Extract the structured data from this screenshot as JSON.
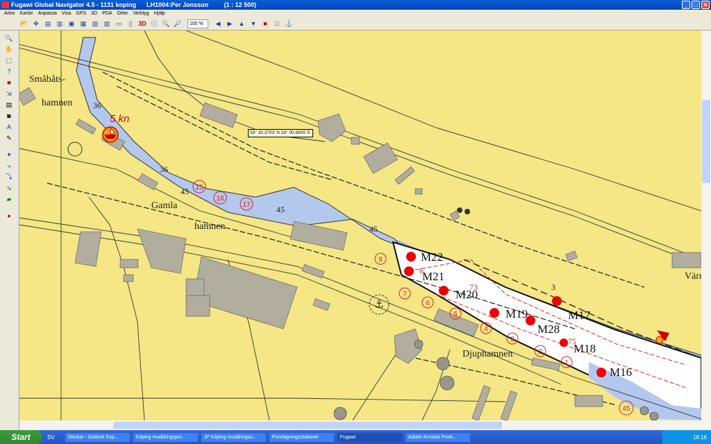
{
  "window": {
    "title": "Fugawi Global Navigator 4.5 - 1131 koping      LH1004:Per Jonsson         (1 : 12 500)",
    "buttons": [
      "_",
      "□",
      "✕"
    ]
  },
  "menu": [
    "Arkiv",
    "Kartor",
    "Anpassa",
    "Visa",
    "GPS",
    "3D",
    "PDA",
    "Orter",
    "Verktyg",
    "Hjälp"
  ],
  "toolbar": {
    "zoom": "100 %"
  },
  "map": {
    "tooltip": "59° 30,3703' N 16° 00,6905' E",
    "place_names": {
      "smabats": "Småbåts-",
      "hamnen1": "hamnen",
      "gamla": "Gamla",
      "hamnen2": "hamnen",
      "djuphamnen": "Djuphamnen",
      "varn": "Värn"
    },
    "speed_label": "5 kn",
    "depths": [
      "36",
      "36",
      "45",
      "45",
      "45",
      "3",
      "75",
      "73",
      "6"
    ],
    "circled_numbers": [
      "15",
      "16",
      "17",
      "8",
      "7",
      "6",
      "5",
      "4",
      "3",
      "2",
      "1",
      "45"
    ],
    "samples": [
      "M22",
      "M21",
      "M20",
      "M19",
      "M28",
      "M17",
      "M18",
      "M16"
    ]
  },
  "taskbar": {
    "start": "Start",
    "lang": "SV",
    "tasks": [
      "Skickat - Outlook Exp...",
      "Köping muddringspro...",
      "JP Köping muddringso...",
      "Provtagningsstationer",
      "Fugawi",
      "Adobe Acrobat Profe..."
    ],
    "clock": "16:16"
  }
}
